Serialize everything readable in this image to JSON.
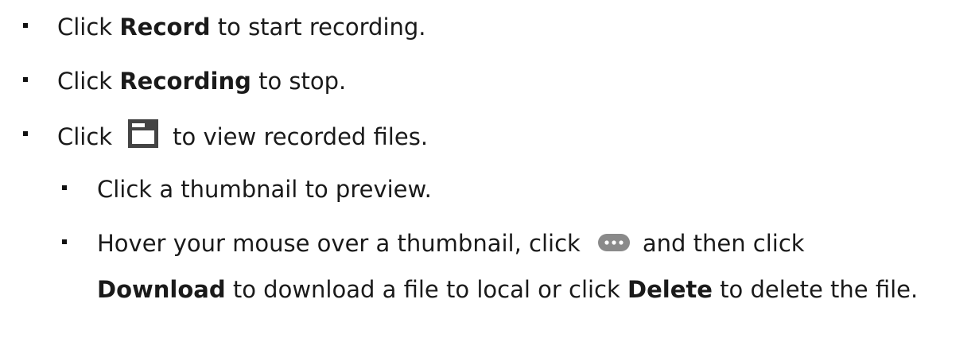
{
  "list": {
    "item1": {
      "pre": "Click ",
      "bold": "Record",
      "post": " to start recording."
    },
    "item2": {
      "pre": "Click ",
      "bold": "Recording",
      "post": " to stop."
    },
    "item3": {
      "pre": "Click",
      "icon": "folder-icon",
      "post": "to view recorded files."
    },
    "sub1": {
      "text": "Click a thumbnail to preview."
    },
    "sub2": {
      "pre": "Hover your mouse over a thumbnail, click",
      "icon": "more-options-icon",
      "post": "and then click",
      "line2_bold1": "Download",
      "line2_mid": " to download a file to local or click ",
      "line2_bold2": "Delete",
      "line2_end": " to delete the file."
    }
  },
  "colors": {
    "text": "#1a1a1a",
    "icon": "#444444",
    "more_icon": "#8a8a8a"
  }
}
